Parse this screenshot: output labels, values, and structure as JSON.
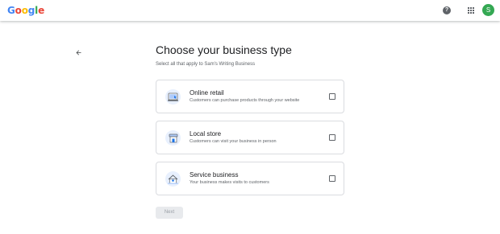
{
  "header": {
    "logo_letters": [
      {
        "char": "G",
        "color": "#4285F4"
      },
      {
        "char": "o",
        "color": "#EA4335"
      },
      {
        "char": "o",
        "color": "#FBBC05"
      },
      {
        "char": "g",
        "color": "#4285F4"
      },
      {
        "char": "l",
        "color": "#34A853"
      },
      {
        "char": "e",
        "color": "#EA4335"
      }
    ],
    "help_icon_glyph": "?",
    "apps_icon": "apps-grid-icon",
    "avatar_initial": "S",
    "avatar_color": "#34A853"
  },
  "page": {
    "title": "Choose your business type",
    "subtitle": "Select all that apply to Sam's Writing Business",
    "back_icon": "arrow-back-icon"
  },
  "options": [
    {
      "title": "Online retail",
      "description": "Customers can purchase products through your website",
      "icon": "online-retail-illustration-icon",
      "checked": false
    },
    {
      "title": "Local store",
      "description": "Customers can visit your business in person",
      "icon": "local-store-illustration-icon",
      "checked": false
    },
    {
      "title": "Service business",
      "description": "Your business makes visits to customers",
      "icon": "service-business-illustration-icon",
      "checked": false
    }
  ],
  "actions": {
    "next_label": "Next",
    "next_enabled": false
  },
  "colors": {
    "accent": "#1a73e8",
    "border": "#dadce0",
    "disabled_bg": "#e8eaed",
    "disabled_text": "#9aa0a6"
  }
}
